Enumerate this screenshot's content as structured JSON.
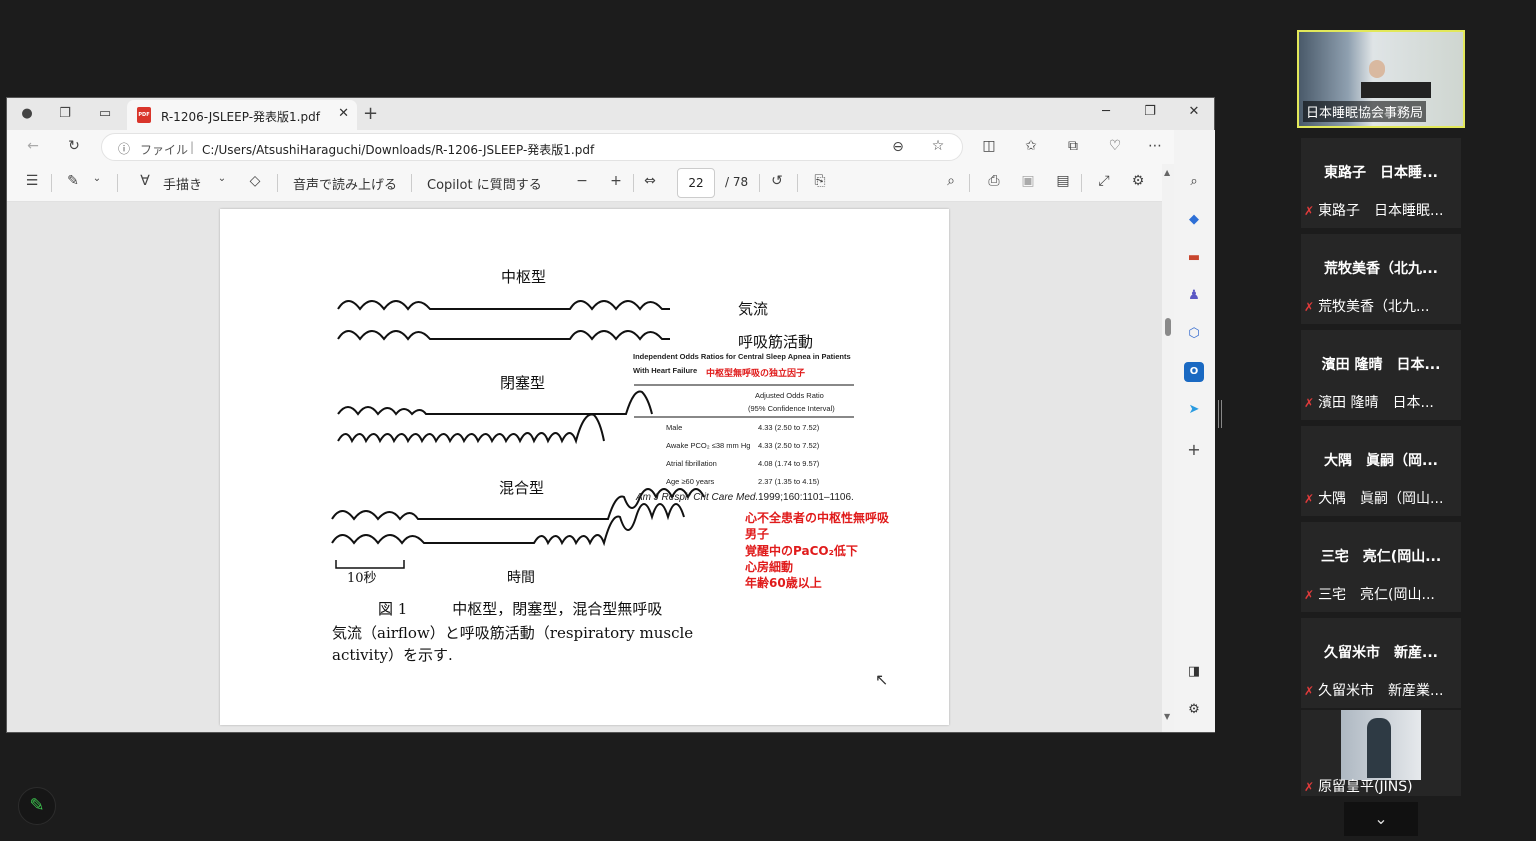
{
  "browser": {
    "tab_title": "R-1206-JSLEEP-発表版1.pdf",
    "tab_close": "✕",
    "new_tab": "+",
    "address_label": "ファイル",
    "address_url": "C:/Users/AtsushiHaraguchi/Downloads/R-1206-JSLEEP-発表版1.pdf"
  },
  "pdf_toolbar": {
    "draw_label": "手描き",
    "read_aloud_label": "音声で読み上げる",
    "copilot_label": "Copilot に質問する",
    "page_current": "22",
    "page_total": "/ 78"
  },
  "pdf_page": {
    "central_label": "中枢型",
    "obstructive_label": "閉塞型",
    "mixed_label": "混合型",
    "airflow_label": "気流",
    "muscle_label": "呼吸筋活動",
    "scale_label": "10秒",
    "time_label": "時間",
    "table_title_en_1": "Independent Odds Ratios for Central Sleep Apnea in Patients",
    "table_title_en_2": "With Heart Failure",
    "table_title_jp": "中枢型無呼吸の独立因子",
    "table_header_1": "Adjusted Odds Ratio",
    "table_header_2": "(95% Confidence Interval)",
    "table_rows": [
      {
        "factor": "Male",
        "value": "4.33 (2.50 to 7.52)"
      },
      {
        "factor": "Awake PCO₂ ≤38 mm Hg",
        "value": "4.33 (2.50 to 7.52)"
      },
      {
        "factor": "Atrial fibrillation",
        "value": "4.08 (1.74 to 9.57)"
      },
      {
        "factor": "Age ≥60 years",
        "value": "2.37 (1.35 to 4.15)"
      }
    ],
    "citation_journal": "Am J Respir Crit Care Med.",
    "citation_ref": " 1999;160:1101–1106.",
    "red_notes": [
      "心不全患者の中枢性無呼吸",
      "男子",
      "覚醒中のPaCO₂低下",
      "心房細動",
      "年齢60歳以上"
    ],
    "figure_caption": "図 1　　　中枢型，閉塞型，混合型無呼吸",
    "caption_line2": "気流（airflow）と呼吸筋活動（respiratory muscle",
    "caption_line3": "activity）を示す."
  },
  "participants": {
    "main_video_name": "日本睡眠協会事務局",
    "tiles": [
      {
        "title": "東路子　日本睡...",
        "name": "東路子　日本睡眠..."
      },
      {
        "title": "荒牧美香（北九...",
        "name": "荒牧美香（北九..."
      },
      {
        "title": "濱田 隆晴　日本...",
        "name": "濱田 隆晴　日本..."
      },
      {
        "title": "大隅　眞嗣（岡...",
        "name": "大隅　眞嗣（岡山..."
      },
      {
        "title": "三宅　亮仁(岡山...",
        "name": "三宅　亮仁(岡山..."
      },
      {
        "title": "久留米市　新産...",
        "name": "久留米市　新産業..."
      }
    ],
    "last_video_name": "原留皇平(JINS)"
  }
}
